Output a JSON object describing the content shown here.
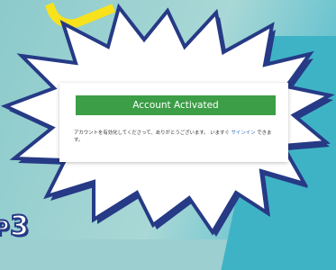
{
  "banner": {
    "text": "Account Activated"
  },
  "message": {
    "before": "アカウントを有効化してくださって、ありがとうございます。 いますぐ ",
    "link": "サインイン",
    "after": " できます。"
  },
  "step": {
    "prefix": "P",
    "number": "3"
  },
  "colors": {
    "banner_green": "#3c9e46",
    "burst_outline": "#263a86",
    "link_blue": "#2a6ebb",
    "accent_yellow": "#f7e21c",
    "background_teal": "#9ccfd0"
  }
}
